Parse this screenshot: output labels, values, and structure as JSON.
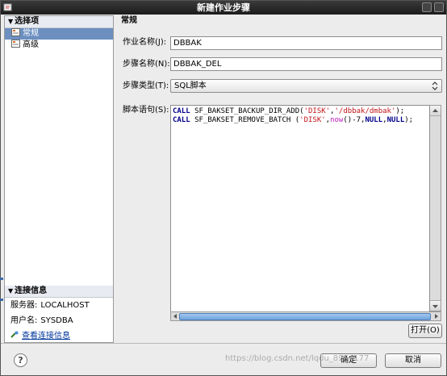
{
  "window": {
    "title": "新建作业步骤"
  },
  "left": {
    "select_header": "选择项",
    "items": [
      {
        "label": "常规",
        "icon": "general-settings-icon",
        "selected": true
      },
      {
        "label": "高级",
        "icon": "advanced-settings-icon",
        "selected": false
      }
    ],
    "conn_header": "连接信息",
    "server_label": "服务器:",
    "server_value": "LOCALHOST",
    "user_label": "用户名:",
    "user_value": "SYSDBA",
    "view_link": "查看连接信息"
  },
  "right": {
    "header": "常规",
    "job_name_label": "作业名称(J):",
    "job_name_value": "DBBAK",
    "step_name_label": "步骤名称(N):",
    "step_name_value": "DBBAK_DEL",
    "step_type_label": "步骤类型(T):",
    "step_type_value": "SQL脚本",
    "script_label": "脚本语句(S):",
    "script_lines": [
      [
        {
          "t": "CALL",
          "c": "kw"
        },
        {
          "t": " SF_BAKSET_BACKUP_DIR_ADD(",
          "c": ""
        },
        {
          "t": "'DISK'",
          "c": "str"
        },
        {
          "t": ",",
          "c": ""
        },
        {
          "t": "'/dbbak/dmbak'",
          "c": "str"
        },
        {
          "t": ");",
          "c": ""
        }
      ],
      [
        {
          "t": "CALL",
          "c": "kw"
        },
        {
          "t": " SF_BAKSET_REMOVE_BATCH (",
          "c": ""
        },
        {
          "t": "'DISK'",
          "c": "str"
        },
        {
          "t": ",",
          "c": ""
        },
        {
          "t": "now",
          "c": "fn"
        },
        {
          "t": "()-7,",
          "c": ""
        },
        {
          "t": "NULL",
          "c": "kw"
        },
        {
          "t": ",",
          "c": ""
        },
        {
          "t": "NULL",
          "c": "kw"
        },
        {
          "t": ");",
          "c": ""
        }
      ]
    ],
    "open_button": "打开(O)"
  },
  "footer": {
    "ok_button": "确定",
    "cancel_button": "取消",
    "help": "?",
    "watermark": "https://blog.csdn.net/lqdu_8964177"
  }
}
